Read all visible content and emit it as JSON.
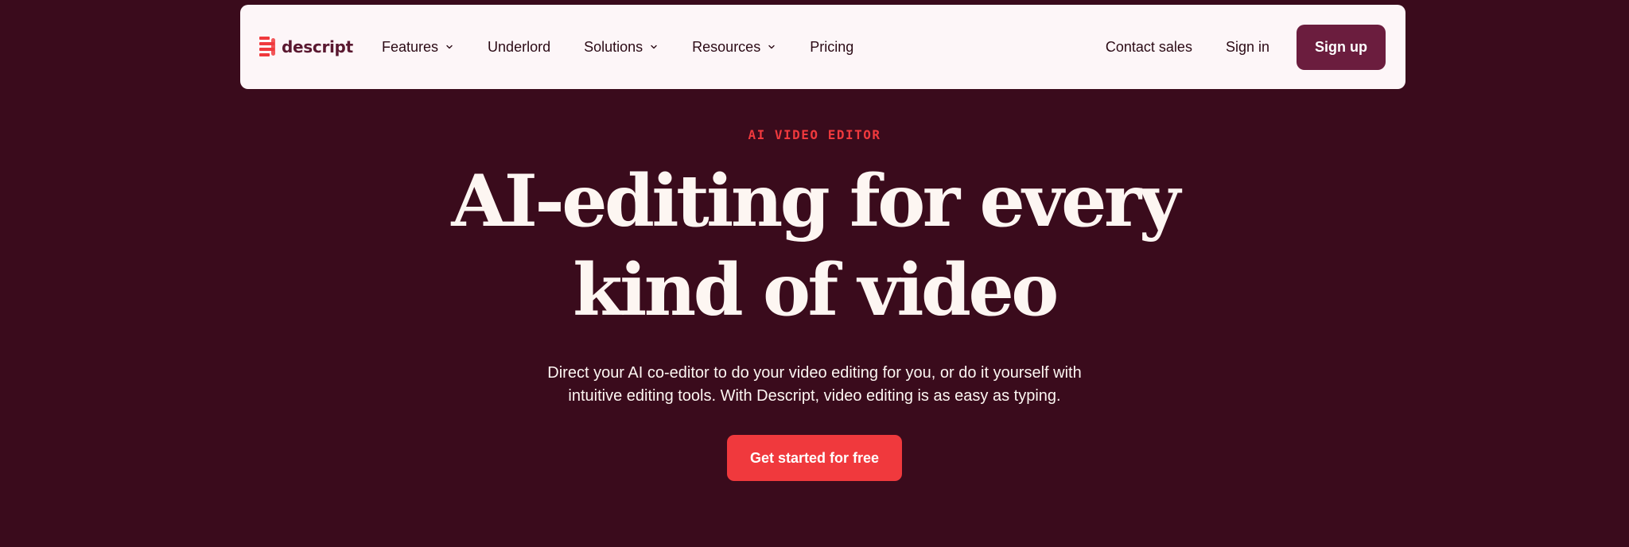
{
  "colors": {
    "background": "#3a0b1c",
    "nav_background": "#fdf6f8",
    "brand": "#5a1830",
    "accent": "#f0393d",
    "signup_button": "#6b1d3e",
    "headline_text": "#fdf6f2"
  },
  "nav": {
    "brand_name": "descript",
    "brand_icon": "descript-logo-icon",
    "links": [
      {
        "label": "Features",
        "has_dropdown": true
      },
      {
        "label": "Underlord",
        "has_dropdown": false
      },
      {
        "label": "Solutions",
        "has_dropdown": true
      },
      {
        "label": "Resources",
        "has_dropdown": true
      },
      {
        "label": "Pricing",
        "has_dropdown": false
      }
    ],
    "contact_sales": "Contact sales",
    "sign_in": "Sign in",
    "sign_up": "Sign up",
    "dropdown_icon": "chevron-down-icon"
  },
  "hero": {
    "eyebrow": "AI VIDEO EDITOR",
    "headline_line1": "AI-editing for every",
    "headline_line2": "kind of video",
    "subtitle": "Direct your AI co-editor to do your video editing for you, or do it yourself with intuitive editing tools. With Descript, video editing is as easy as typing.",
    "cta": "Get started for free"
  }
}
